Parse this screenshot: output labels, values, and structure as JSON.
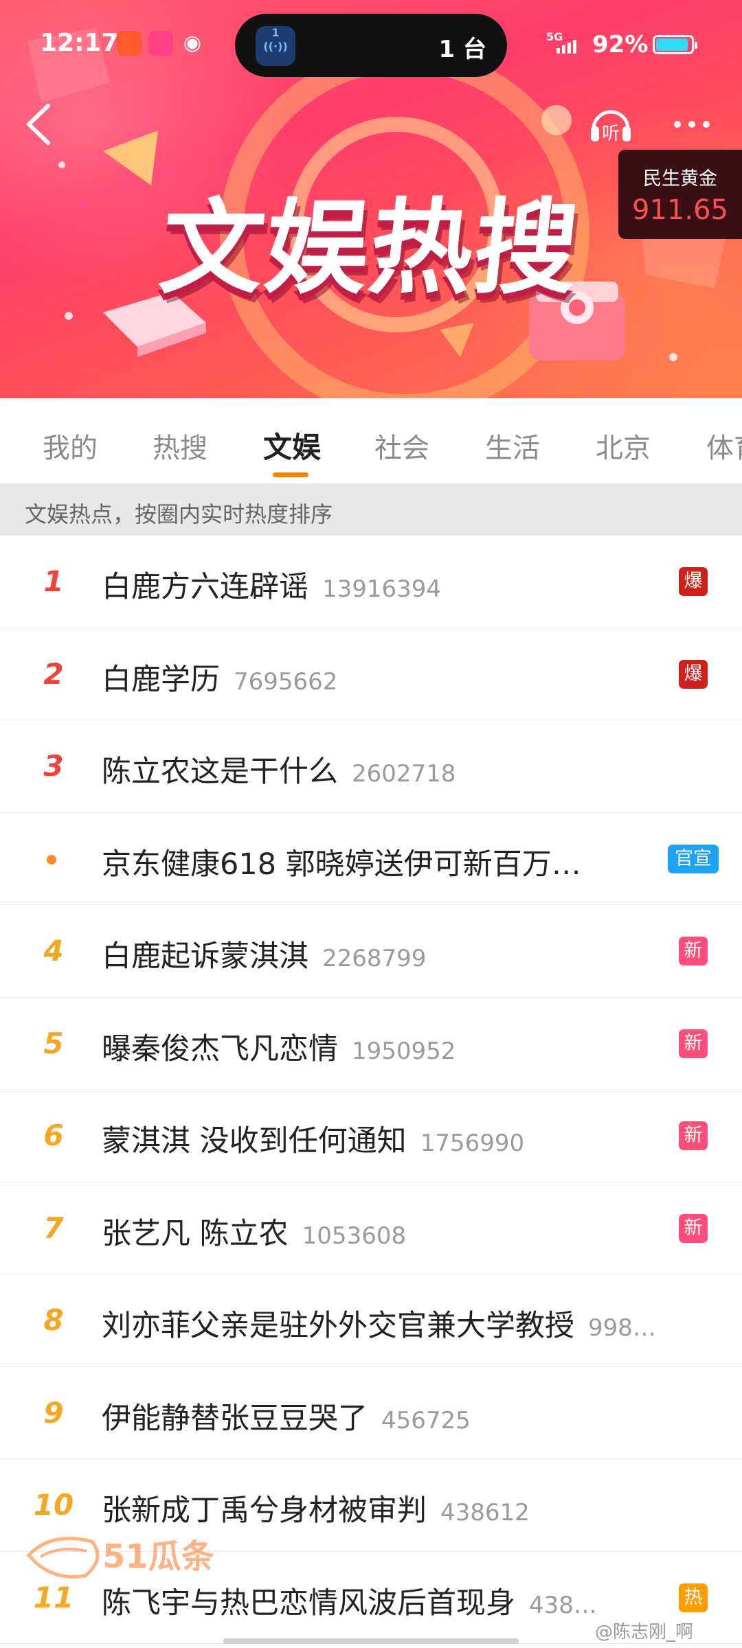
{
  "status_bar": {
    "time": "12:17",
    "island_app_number": "1",
    "island_text": "1 台",
    "network": "5G",
    "battery_percent": "92%",
    "battery_level": 0.92
  },
  "header": {
    "title": "文娱热搜",
    "listen_label": "听",
    "ticker": {
      "name": "民生黄金",
      "value": "911.65"
    }
  },
  "tabs": [
    {
      "label": "我的"
    },
    {
      "label": "热搜"
    },
    {
      "label": "文娱",
      "active": true
    },
    {
      "label": "社会"
    },
    {
      "label": "生活"
    },
    {
      "label": "北京"
    },
    {
      "label": "体育"
    }
  ],
  "subheader": "文娱热点，按圈内实时热度排序",
  "list": [
    {
      "rank": "1",
      "topic": "白鹿方六连辟谣",
      "heat": "13916394",
      "badge": "爆"
    },
    {
      "rank": "2",
      "topic": "白鹿学历",
      "heat": "7695662",
      "badge": "爆"
    },
    {
      "rank": "3",
      "topic": "陈立农这是干什么",
      "heat": "2602718",
      "badge": ""
    },
    {
      "rank": "•",
      "topic": "京东健康618 郭晓婷送伊可新百万…",
      "heat": "",
      "badge": "官宣"
    },
    {
      "rank": "4",
      "topic": "白鹿起诉蒙淇淇",
      "heat": "2268799",
      "badge": "新"
    },
    {
      "rank": "5",
      "topic": "曝秦俊杰飞凡恋情",
      "heat": "1950952",
      "badge": "新"
    },
    {
      "rank": "6",
      "topic": "蒙淇淇 没收到任何通知",
      "heat": "1756990",
      "badge": "新"
    },
    {
      "rank": "7",
      "topic": "张艺凡 陈立农",
      "heat": "1053608",
      "badge": "新"
    },
    {
      "rank": "8",
      "topic": "刘亦菲父亲是驻外外交官兼大学教授",
      "heat": "998…",
      "badge": ""
    },
    {
      "rank": "9",
      "topic": "伊能静替张豆豆哭了",
      "heat": "456725",
      "badge": ""
    },
    {
      "rank": "10",
      "topic": "张新成丁禹兮身材被审判",
      "heat": "438612",
      "badge": ""
    },
    {
      "rank": "11",
      "topic": "陈飞宇与热巴恋情风波后首现身",
      "heat": "438…",
      "badge": "热"
    }
  ],
  "watermarks": {
    "left": "51瓜条",
    "right": "@陈志刚_啊"
  },
  "colors": {
    "accent": "#ff8200",
    "rank_top": "#f0423a",
    "rank_other": "#f5a623",
    "badge_explode": "#d0201c",
    "badge_new": "#ff4d7a",
    "badge_hot": "#ff9d00",
    "badge_official": "#1da1f2"
  }
}
